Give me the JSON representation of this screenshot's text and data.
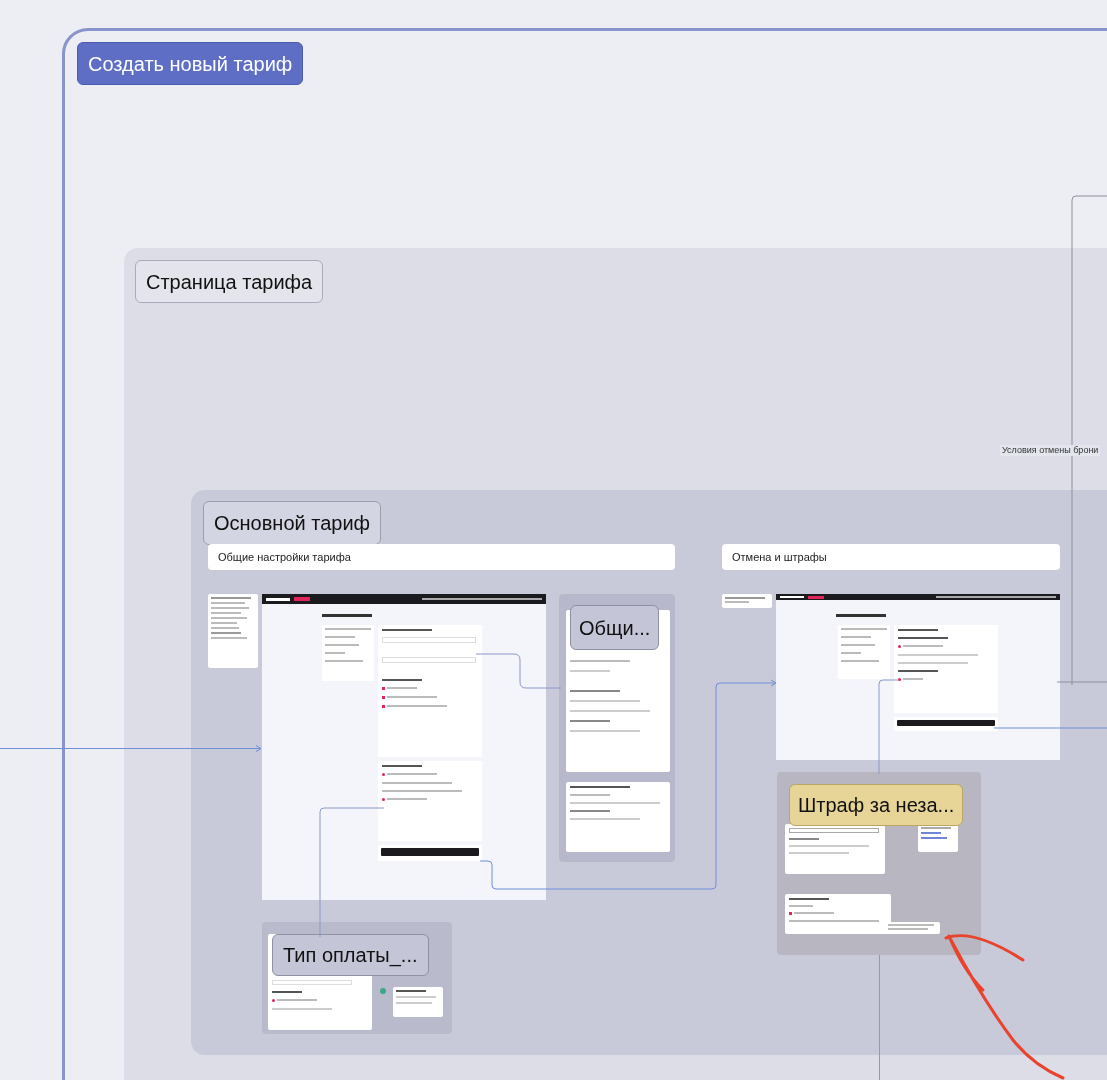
{
  "board": {
    "button": "Создать новый тариф",
    "section": {
      "title": "Страница тарифа",
      "connector_label": "Условия отмены брони",
      "subsection": {
        "title": "Основной тариф",
        "columns": [
          {
            "title": "Общие настройки тарифа"
          },
          {
            "title": "Отмена и штрафы"
          }
        ],
        "frames": [
          {
            "label": "Общи...",
            "kind": "plain"
          },
          {
            "label": "Штраф за неза...",
            "kind": "highlight"
          },
          {
            "label": "Тип оплаты_...",
            "kind": "plain"
          }
        ]
      }
    }
  }
}
